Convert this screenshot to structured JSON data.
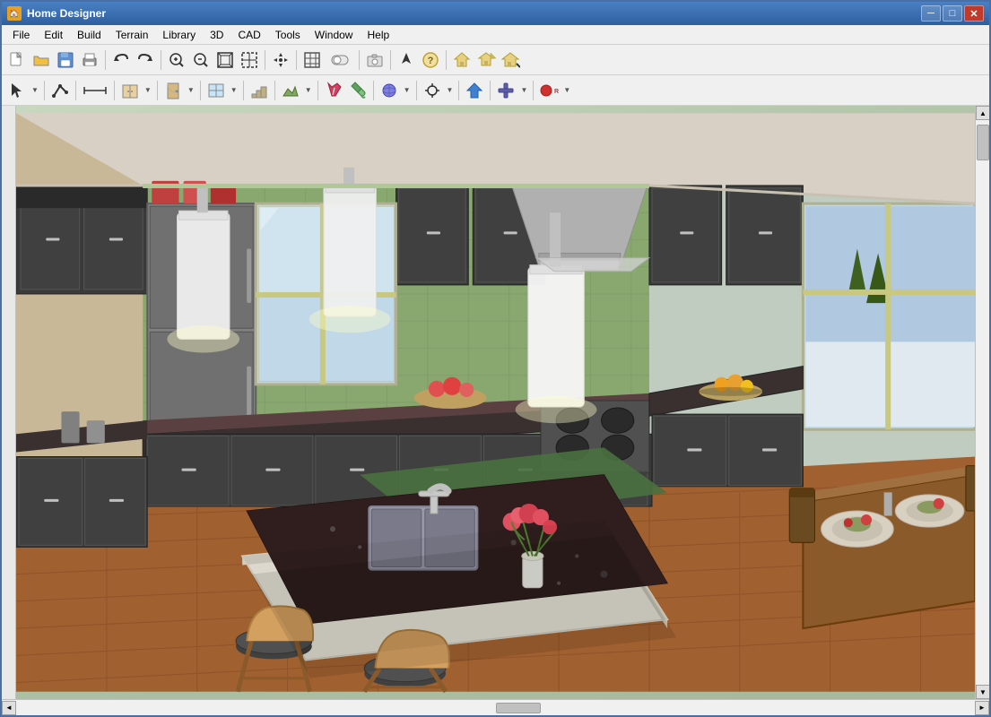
{
  "window": {
    "title": "Home Designer",
    "icon": "🏠"
  },
  "title_controls": {
    "minimize": "─",
    "maximize": "□",
    "close": "✕"
  },
  "menu": {
    "items": [
      "File",
      "Edit",
      "Build",
      "Terrain",
      "Library",
      "3D",
      "CAD",
      "Tools",
      "Window",
      "Help"
    ]
  },
  "toolbar1": {
    "buttons": [
      {
        "name": "new",
        "icon": "📄",
        "label": "New"
      },
      {
        "name": "open",
        "icon": "📂",
        "label": "Open"
      },
      {
        "name": "save",
        "icon": "💾",
        "label": "Save"
      },
      {
        "name": "print",
        "icon": "🖨",
        "label": "Print"
      },
      {
        "name": "undo",
        "icon": "↩",
        "label": "Undo"
      },
      {
        "name": "redo",
        "icon": "↪",
        "label": "Redo"
      },
      {
        "name": "zoom-in",
        "icon": "🔍",
        "label": "Zoom In"
      },
      {
        "name": "zoom-out",
        "icon": "🔎",
        "label": "Zoom Out"
      },
      {
        "name": "fill-window",
        "icon": "⊡",
        "label": "Fill Window"
      },
      {
        "name": "zoom-box",
        "icon": "⊞",
        "label": "Zoom Box"
      },
      {
        "name": "pan",
        "icon": "✋",
        "label": "Pan"
      },
      {
        "name": "ref-grid",
        "icon": "⊟",
        "label": "Reference Grid"
      },
      {
        "name": "camera",
        "icon": "📷",
        "label": "Camera"
      },
      {
        "name": "question",
        "icon": "?",
        "label": "Help"
      },
      {
        "name": "house1",
        "icon": "🏠",
        "label": "House 1"
      },
      {
        "name": "house2",
        "icon": "🏡",
        "label": "House 2"
      }
    ]
  },
  "toolbar2": {
    "buttons": [
      {
        "name": "select",
        "icon": "↖",
        "label": "Select"
      },
      {
        "name": "polyline",
        "icon": "∟",
        "label": "Polyline"
      },
      {
        "name": "dimension",
        "icon": "⊢",
        "label": "Dimension"
      },
      {
        "name": "cabinet",
        "icon": "▦",
        "label": "Cabinet"
      },
      {
        "name": "door",
        "icon": "🚪",
        "label": "Door"
      },
      {
        "name": "window",
        "icon": "⊞",
        "label": "Window"
      },
      {
        "name": "stairs",
        "icon": "≡",
        "label": "Stairs"
      },
      {
        "name": "terrain",
        "icon": "⬟",
        "label": "Terrain"
      },
      {
        "name": "paint",
        "icon": "🖌",
        "label": "Paint"
      },
      {
        "name": "fill",
        "icon": "⬛",
        "label": "Fill"
      },
      {
        "name": "material",
        "icon": "🎨",
        "label": "Material"
      },
      {
        "name": "transform",
        "icon": "✦",
        "label": "Transform"
      },
      {
        "name": "arrow-up",
        "icon": "⬆",
        "label": "Arrow Up"
      },
      {
        "name": "cross",
        "icon": "✛",
        "label": "Cross"
      },
      {
        "name": "rec",
        "icon": "⏺",
        "label": "Record"
      }
    ]
  },
  "scene": {
    "description": "3D Kitchen Interior View",
    "background_color": "#c4d4bc"
  },
  "status": {
    "text": ""
  }
}
